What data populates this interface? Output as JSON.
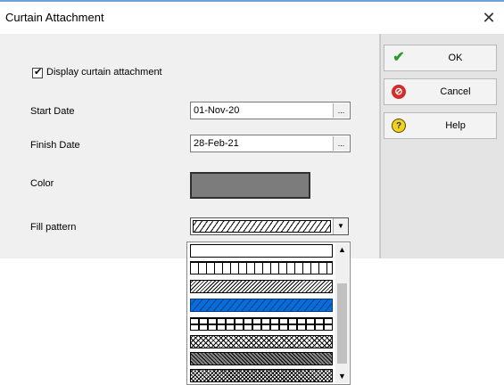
{
  "window": {
    "title": "Curtain Attachment",
    "close_glyph": "✕"
  },
  "form": {
    "display_checkbox": {
      "label": "Display curtain attachment",
      "checked": true,
      "check_glyph": "✔"
    },
    "start_date": {
      "label": "Start Date",
      "value": "01-Nov-20",
      "button_glyph": "..."
    },
    "finish_date": {
      "label": "Finish Date",
      "value": "28-Feb-21",
      "button_glyph": "..."
    },
    "color": {
      "label": "Color",
      "value": "#7c7c7c"
    },
    "fill_pattern": {
      "label": "Fill pattern",
      "selected_index": 3,
      "arrow_glyph": "▼"
    }
  },
  "buttons": {
    "ok": {
      "label": "OK",
      "icon": "checkmark-icon",
      "glyph": "✔"
    },
    "cancel": {
      "label": "Cancel",
      "icon": "cancel-icon",
      "glyph": "⊘"
    },
    "help": {
      "label": "Help",
      "icon": "help-icon",
      "glyph": "?"
    }
  },
  "dropdown": {
    "patterns": [
      "blank",
      "vertical-lines",
      "diagonal-crosshatch-fine",
      "diagonal-lines-selected",
      "grid",
      "diagonal-crosshatch",
      "dense-dark",
      "diagonal-crosshatch-dense"
    ],
    "scroll_up_glyph": "▲",
    "scroll_down_glyph": "▼"
  },
  "colors": {
    "accent_selected": "#0a6cd8",
    "window_border": "#6f9fd8",
    "ok_icon": "#2d9a2d",
    "cancel_icon": "#d42b2b",
    "help_icon": "#f2d21a"
  }
}
